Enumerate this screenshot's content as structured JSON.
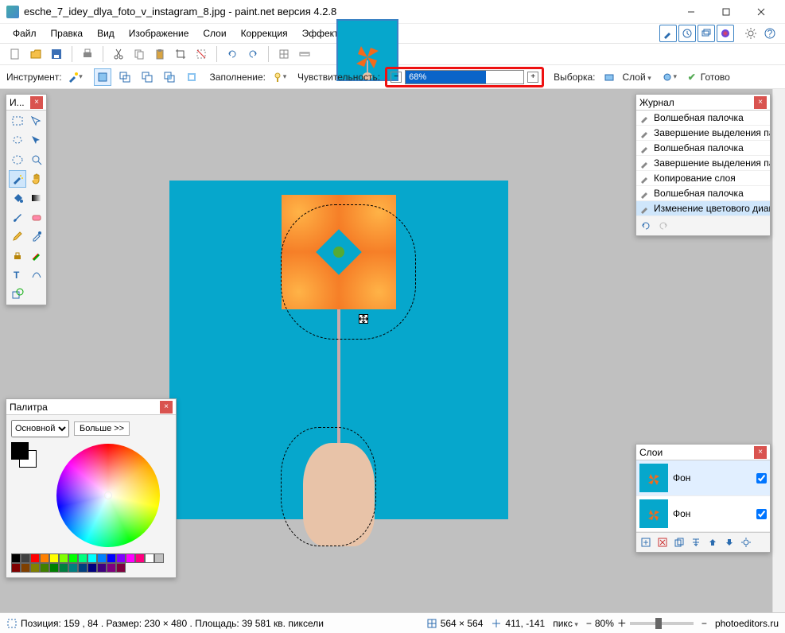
{
  "window": {
    "title": "esche_7_idey_dlya_foto_v_instagram_8.jpg - paint.net версия 4.2.8"
  },
  "menu": {
    "file": "Файл",
    "edit": "Правка",
    "view": "Вид",
    "image": "Изображение",
    "layers": "Слои",
    "adjustments": "Коррекция",
    "effects": "Эффекты"
  },
  "options": {
    "tool_label": "Инструмент:",
    "fill_label": "Заполнение:",
    "tolerance_label": "Чувствительность:",
    "tolerance_value": "68%",
    "tolerance_fill_width": "68%",
    "sampling_label": "Выборка:",
    "sampling_value": "Слой",
    "finish_label": "Готово"
  },
  "tools_panel": {
    "title": "И..."
  },
  "history": {
    "title": "Журнал",
    "items": [
      "Волшебная палочка",
      "Завершение выделения палочкой",
      "Волшебная палочка",
      "Завершение выделения палочкой",
      "Копирование слоя",
      "Волшебная палочка",
      "Изменение цветового диапазона"
    ],
    "selected_index": 6
  },
  "palette": {
    "title": "Палитра",
    "mode": "Основной",
    "more": "Больше >>",
    "swatches": [
      "#000000",
      "#404040",
      "#ff0000",
      "#ff8000",
      "#ffff00",
      "#80ff00",
      "#00ff00",
      "#00ff80",
      "#00ffff",
      "#0080ff",
      "#0000ff",
      "#8000ff",
      "#ff00ff",
      "#ff0080",
      "#ffffff",
      "#c0c0c0",
      "#800000",
      "#804000",
      "#808000",
      "#408000",
      "#008000",
      "#008040",
      "#008080",
      "#004080",
      "#000080",
      "#400080",
      "#800080",
      "#800040"
    ]
  },
  "layers": {
    "title": "Слои",
    "items": [
      {
        "name": "Фон",
        "visible": true
      },
      {
        "name": "Фон",
        "visible": true
      }
    ],
    "selected_index": 0
  },
  "status": {
    "position_label": "Позиция: 159 , 84 . Размер: 230   × 480 . Площадь: 39 581 кв. пиксели",
    "canvas_size": "564 × 564",
    "cursor_pos": "411, -141",
    "units": "пикс",
    "zoom": "80%",
    "site": "photoeditors.ru"
  }
}
